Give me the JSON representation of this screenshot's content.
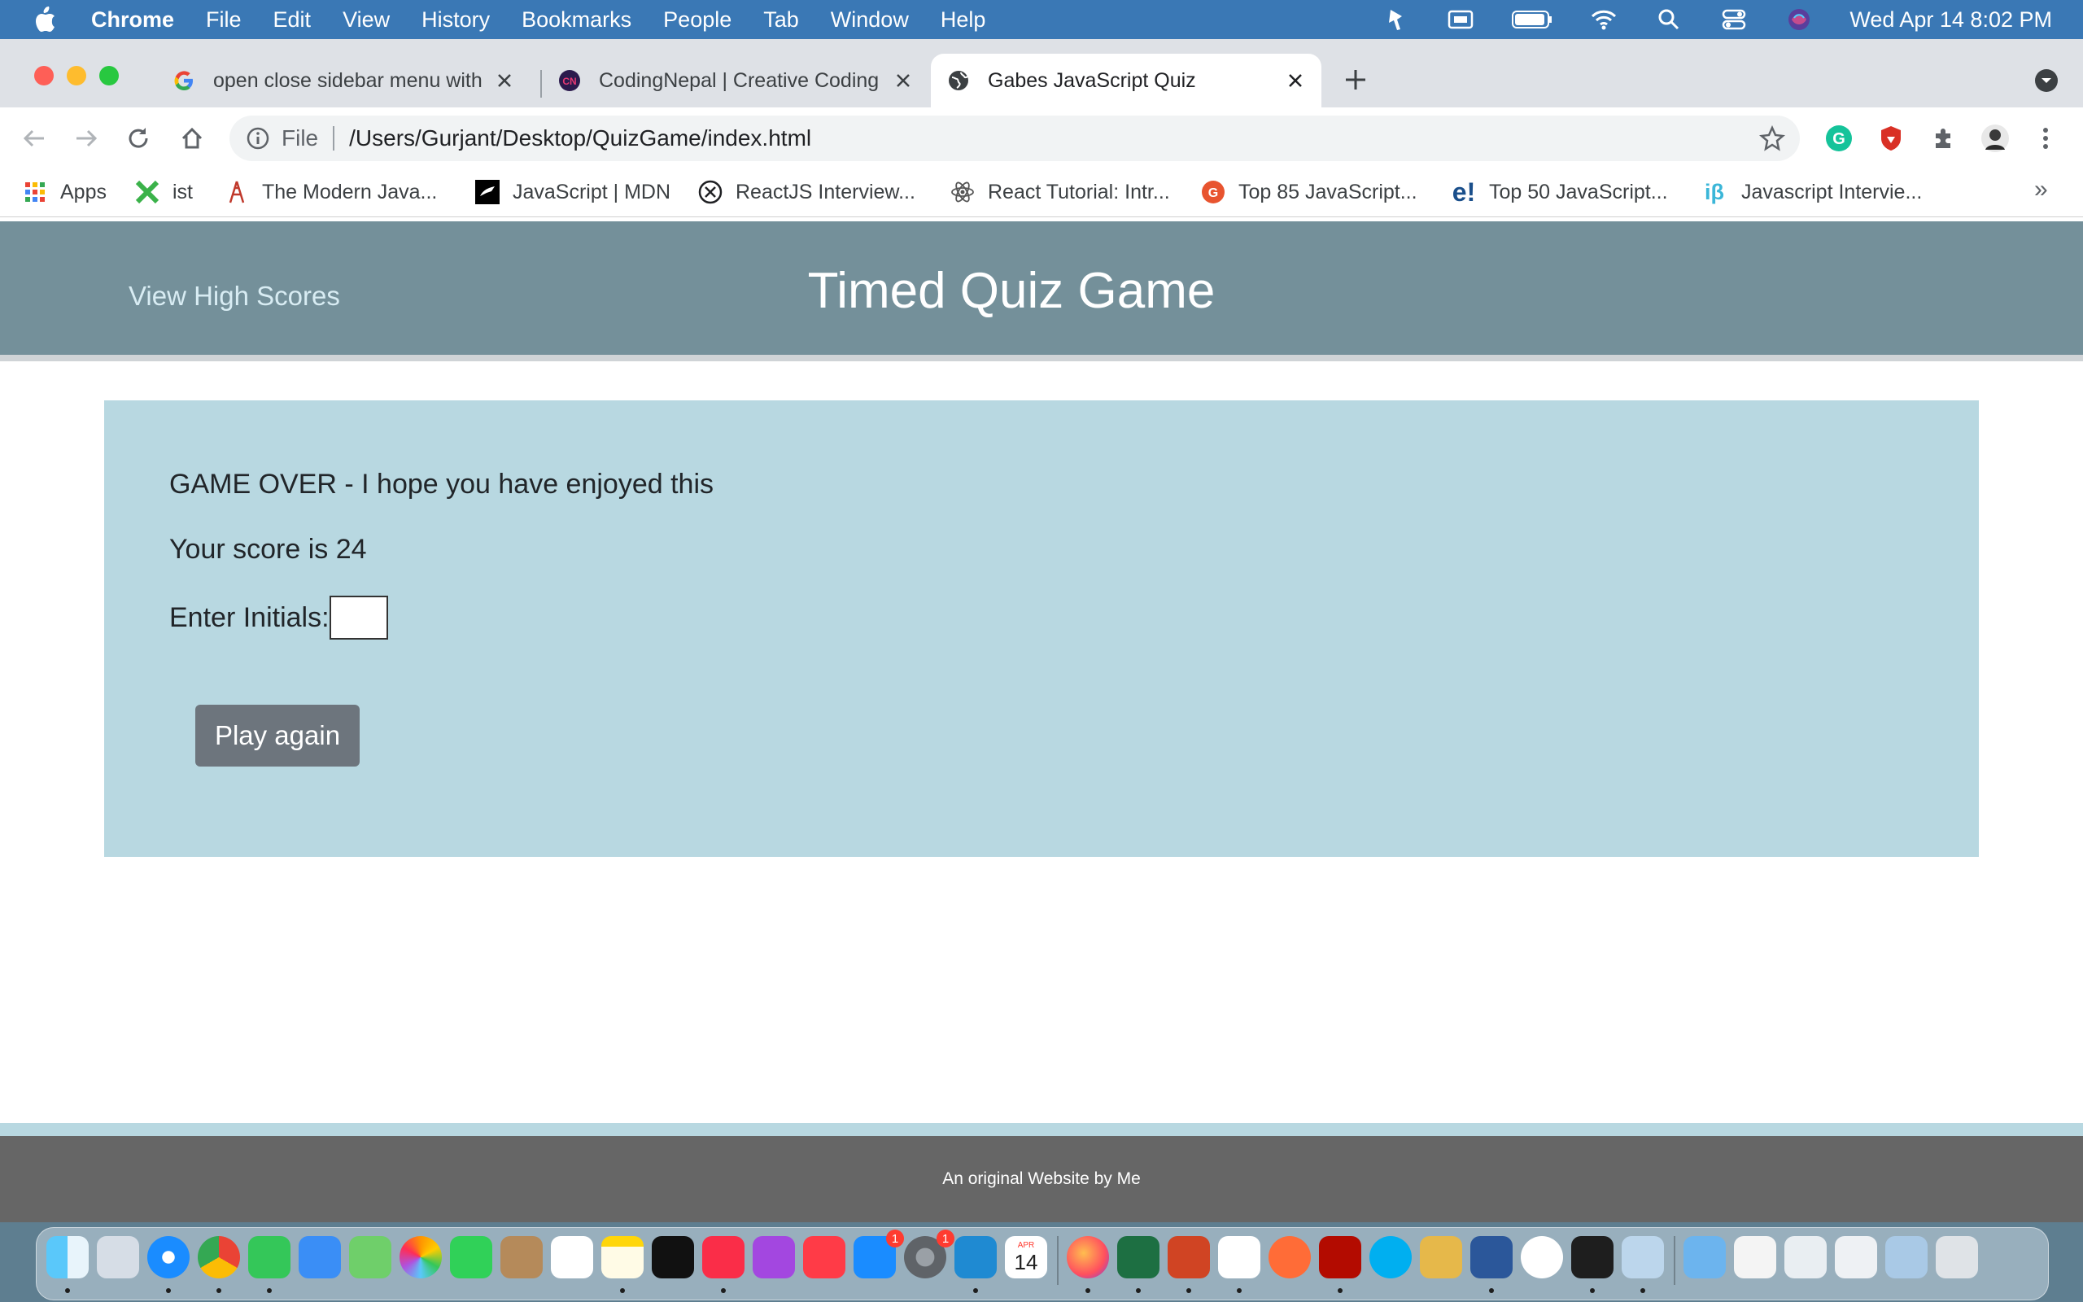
{
  "menubar": {
    "app": "Chrome",
    "items": [
      "File",
      "Edit",
      "View",
      "History",
      "Bookmarks",
      "People",
      "Tab",
      "Window",
      "Help"
    ],
    "clock": "Wed Apr 14  8:02 PM"
  },
  "tabs": [
    {
      "title": "open close sidebar menu with",
      "icon": "google-icon"
    },
    {
      "title": "CodingNepal | Creative Coding",
      "icon": "codingnepal-icon"
    },
    {
      "title": "Gabes JavaScript Quiz",
      "icon": "globe-icon",
      "active": true
    }
  ],
  "omnibox": {
    "scheme": "File",
    "url": "/Users/Gurjant/Desktop/QuizGame/index.html"
  },
  "bookmarks": [
    {
      "label": "Apps",
      "icon": "apps-grid-icon"
    },
    {
      "label": "ist",
      "icon": "x-logo-icon"
    },
    {
      "label": "The Modern Java...",
      "icon": "tower-icon"
    },
    {
      "label": "JavaScript | MDN",
      "icon": "mdn-icon"
    },
    {
      "label": "ReactJS Interview...",
      "icon": "circle-x-icon"
    },
    {
      "label": "React Tutorial: Intr...",
      "icon": "react-icon"
    },
    {
      "label": "Top 85 JavaScript...",
      "icon": "orange-circle-icon"
    },
    {
      "label": "Top 50 JavaScript...",
      "icon": "edureka-icon"
    },
    {
      "label": "Javascript Intervie...",
      "icon": "ib-icon"
    }
  ],
  "page": {
    "header": {
      "view_high_scores": "View High Scores",
      "title": "Timed Quiz Game"
    },
    "quiz": {
      "game_over": "GAME OVER - I hope you have enjoyed this",
      "score_text": "Your score is 24",
      "initials_label": "Enter Initials:",
      "initials_value": "",
      "play_again": "Play again"
    },
    "footer": "An original Website by Me"
  },
  "dock": {
    "badges": {
      "app_store": "1",
      "system_prefs": "1"
    },
    "calendar": {
      "month": "APR",
      "day": "14"
    }
  },
  "colors": {
    "header_bg": "#74909a",
    "quiz_bg": "#b8d8e1",
    "button_bg": "#6d757d",
    "footer_bg": "#666666"
  }
}
